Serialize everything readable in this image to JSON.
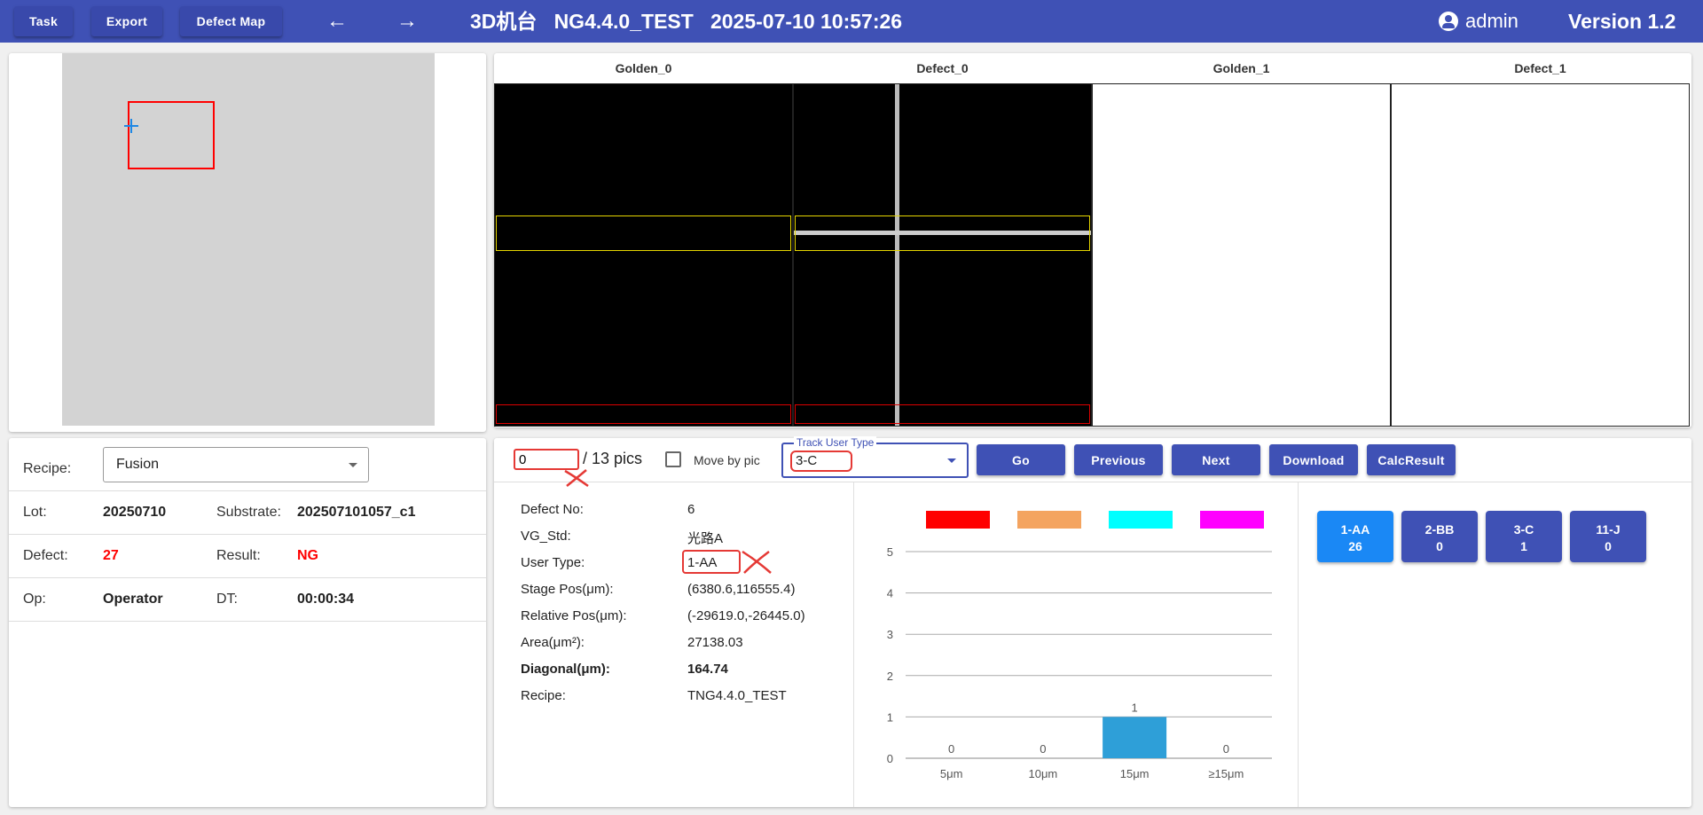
{
  "header": {
    "buttons": [
      "Task",
      "Export",
      "Defect Map"
    ],
    "title": "3D机台   NG4.4.0_TEST   2025-07-10 10:57:26",
    "user": "admin",
    "version": "Version 1.2"
  },
  "images": {
    "headers": [
      "Golden_0",
      "Defect_0",
      "Golden_1",
      "Defect_1"
    ]
  },
  "info": {
    "recipe_label": "Recipe:",
    "recipe_value": "Fusion",
    "lot_label": "Lot:",
    "lot_value": "20250710",
    "substrate_label": "Substrate:",
    "substrate_value": "202507101057_c1",
    "defect_label": "Defect:",
    "defect_value": "27",
    "result_label": "Result:",
    "result_value": "NG",
    "op_label": "Op:",
    "op_value": "Operator",
    "dt_label": "DT:",
    "dt_value": "00:00:34"
  },
  "controls": {
    "pic_index": "0",
    "pic_total": "/ 13 pics",
    "move_by_pic": "Move by pic",
    "track_label": "Track User Type",
    "track_value": "3-C",
    "buttons": [
      "Go",
      "Previous",
      "Next",
      "Download",
      "CalcResult"
    ]
  },
  "details": [
    {
      "label": "Defect No:",
      "value": "6",
      "bold": false
    },
    {
      "label": "VG_Std:",
      "value": "光路A",
      "bold": false
    },
    {
      "label": "User Type:",
      "value": "1-AA",
      "bold": false
    },
    {
      "label": "Stage Pos(μm):",
      "value": "(6380.6,116555.4)",
      "bold": false
    },
    {
      "label": "Relative Pos(μm):",
      "value": "(-29619.0,-26445.0)",
      "bold": false
    },
    {
      "label": "Area(μm²):",
      "value": "27138.03",
      "bold": false
    },
    {
      "label": "Diagonal(μm):",
      "value": "164.74",
      "bold": true
    },
    {
      "label": "Recipe:",
      "value": "TNG4.4.0_TEST",
      "bold": false
    }
  ],
  "chart_data": {
    "type": "bar",
    "categories": [
      "5μm",
      "10μm",
      "15μm",
      "≥15μm"
    ],
    "values": [
      0,
      0,
      1,
      0
    ],
    "ylim": [
      0,
      5
    ],
    "yticks": [
      0,
      1,
      2,
      3,
      4,
      5
    ],
    "legend_colors": [
      "#ff0000",
      "#f4a460",
      "#00ffff",
      "#ff00ff"
    ],
    "bar_color": "#2e9fd8",
    "grid": true
  },
  "user_types": [
    {
      "name": "1-AA",
      "count": "26",
      "color": "#1a88f5"
    },
    {
      "name": "2-BB",
      "count": "0",
      "color": "#3f51b5"
    },
    {
      "name": "3-C",
      "count": "1",
      "color": "#3f51b5"
    },
    {
      "name": "11-J",
      "count": "0",
      "color": "#3f51b5"
    }
  ]
}
